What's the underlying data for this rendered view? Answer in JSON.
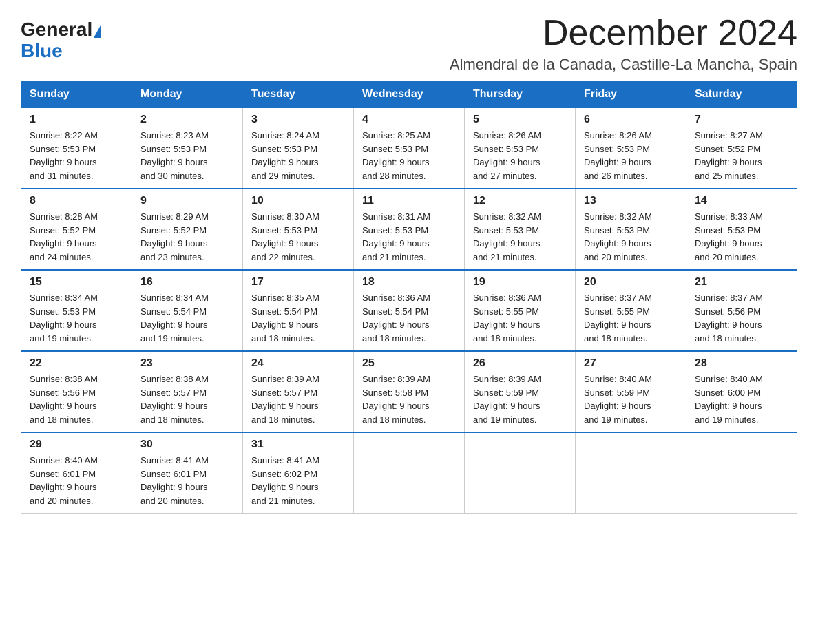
{
  "logo": {
    "general": "General",
    "blue": "Blue"
  },
  "title": "December 2024",
  "location": "Almendral de la Canada, Castille-La Mancha, Spain",
  "days_of_week": [
    "Sunday",
    "Monday",
    "Tuesday",
    "Wednesday",
    "Thursday",
    "Friday",
    "Saturday"
  ],
  "weeks": [
    [
      {
        "day": "1",
        "sunrise": "8:22 AM",
        "sunset": "5:53 PM",
        "daylight": "9 hours and 31 minutes."
      },
      {
        "day": "2",
        "sunrise": "8:23 AM",
        "sunset": "5:53 PM",
        "daylight": "9 hours and 30 minutes."
      },
      {
        "day": "3",
        "sunrise": "8:24 AM",
        "sunset": "5:53 PM",
        "daylight": "9 hours and 29 minutes."
      },
      {
        "day": "4",
        "sunrise": "8:25 AM",
        "sunset": "5:53 PM",
        "daylight": "9 hours and 28 minutes."
      },
      {
        "day": "5",
        "sunrise": "8:26 AM",
        "sunset": "5:53 PM",
        "daylight": "9 hours and 27 minutes."
      },
      {
        "day": "6",
        "sunrise": "8:26 AM",
        "sunset": "5:53 PM",
        "daylight": "9 hours and 26 minutes."
      },
      {
        "day": "7",
        "sunrise": "8:27 AM",
        "sunset": "5:52 PM",
        "daylight": "9 hours and 25 minutes."
      }
    ],
    [
      {
        "day": "8",
        "sunrise": "8:28 AM",
        "sunset": "5:52 PM",
        "daylight": "9 hours and 24 minutes."
      },
      {
        "day": "9",
        "sunrise": "8:29 AM",
        "sunset": "5:52 PM",
        "daylight": "9 hours and 23 minutes."
      },
      {
        "day": "10",
        "sunrise": "8:30 AM",
        "sunset": "5:53 PM",
        "daylight": "9 hours and 22 minutes."
      },
      {
        "day": "11",
        "sunrise": "8:31 AM",
        "sunset": "5:53 PM",
        "daylight": "9 hours and 21 minutes."
      },
      {
        "day": "12",
        "sunrise": "8:32 AM",
        "sunset": "5:53 PM",
        "daylight": "9 hours and 21 minutes."
      },
      {
        "day": "13",
        "sunrise": "8:32 AM",
        "sunset": "5:53 PM",
        "daylight": "9 hours and 20 minutes."
      },
      {
        "day": "14",
        "sunrise": "8:33 AM",
        "sunset": "5:53 PM",
        "daylight": "9 hours and 20 minutes."
      }
    ],
    [
      {
        "day": "15",
        "sunrise": "8:34 AM",
        "sunset": "5:53 PM",
        "daylight": "9 hours and 19 minutes."
      },
      {
        "day": "16",
        "sunrise": "8:34 AM",
        "sunset": "5:54 PM",
        "daylight": "9 hours and 19 minutes."
      },
      {
        "day": "17",
        "sunrise": "8:35 AM",
        "sunset": "5:54 PM",
        "daylight": "9 hours and 18 minutes."
      },
      {
        "day": "18",
        "sunrise": "8:36 AM",
        "sunset": "5:54 PM",
        "daylight": "9 hours and 18 minutes."
      },
      {
        "day": "19",
        "sunrise": "8:36 AM",
        "sunset": "5:55 PM",
        "daylight": "9 hours and 18 minutes."
      },
      {
        "day": "20",
        "sunrise": "8:37 AM",
        "sunset": "5:55 PM",
        "daylight": "9 hours and 18 minutes."
      },
      {
        "day": "21",
        "sunrise": "8:37 AM",
        "sunset": "5:56 PM",
        "daylight": "9 hours and 18 minutes."
      }
    ],
    [
      {
        "day": "22",
        "sunrise": "8:38 AM",
        "sunset": "5:56 PM",
        "daylight": "9 hours and 18 minutes."
      },
      {
        "day": "23",
        "sunrise": "8:38 AM",
        "sunset": "5:57 PM",
        "daylight": "9 hours and 18 minutes."
      },
      {
        "day": "24",
        "sunrise": "8:39 AM",
        "sunset": "5:57 PM",
        "daylight": "9 hours and 18 minutes."
      },
      {
        "day": "25",
        "sunrise": "8:39 AM",
        "sunset": "5:58 PM",
        "daylight": "9 hours and 18 minutes."
      },
      {
        "day": "26",
        "sunrise": "8:39 AM",
        "sunset": "5:59 PM",
        "daylight": "9 hours and 19 minutes."
      },
      {
        "day": "27",
        "sunrise": "8:40 AM",
        "sunset": "5:59 PM",
        "daylight": "9 hours and 19 minutes."
      },
      {
        "day": "28",
        "sunrise": "8:40 AM",
        "sunset": "6:00 PM",
        "daylight": "9 hours and 19 minutes."
      }
    ],
    [
      {
        "day": "29",
        "sunrise": "8:40 AM",
        "sunset": "6:01 PM",
        "daylight": "9 hours and 20 minutes."
      },
      {
        "day": "30",
        "sunrise": "8:41 AM",
        "sunset": "6:01 PM",
        "daylight": "9 hours and 20 minutes."
      },
      {
        "day": "31",
        "sunrise": "8:41 AM",
        "sunset": "6:02 PM",
        "daylight": "9 hours and 21 minutes."
      },
      null,
      null,
      null,
      null
    ]
  ],
  "labels": {
    "sunrise": "Sunrise:",
    "sunset": "Sunset:",
    "daylight": "Daylight:"
  }
}
